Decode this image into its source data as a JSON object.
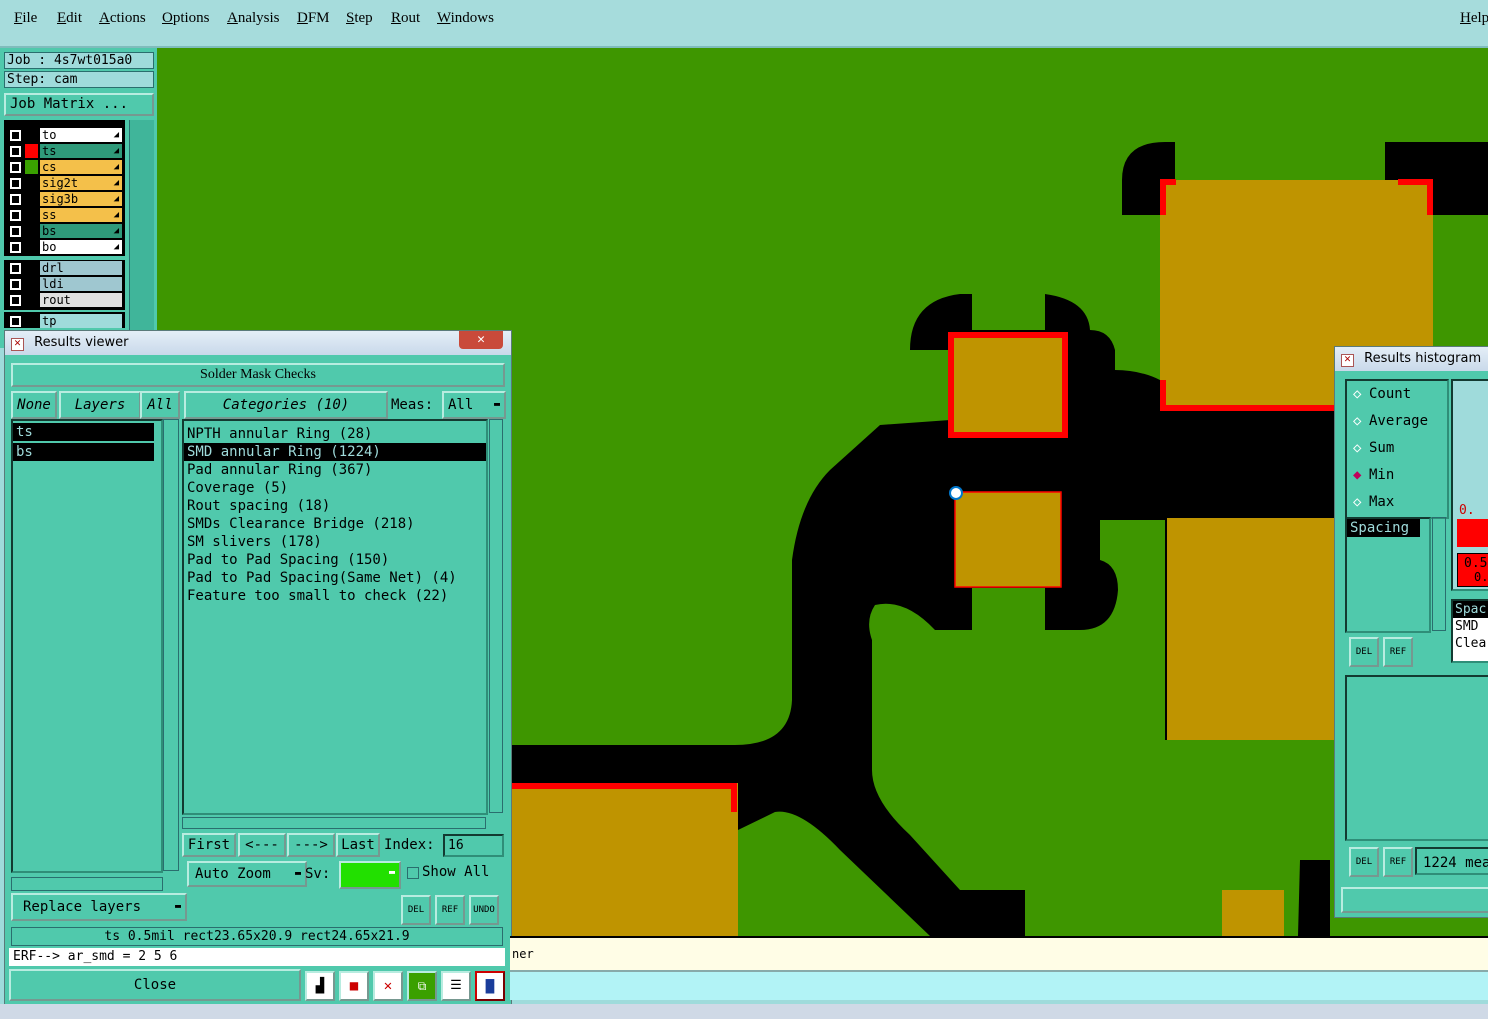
{
  "menubar": {
    "items": [
      "File",
      "Edit",
      "Actions",
      "Options",
      "Analysis",
      "DFM",
      "Step",
      "Rout",
      "Windows"
    ],
    "help": "Help"
  },
  "job": {
    "job_line": "Job : 4s7wt015a0",
    "step_line": "Step: cam",
    "matrix_button": "Job Matrix ..."
  },
  "layers": [
    {
      "name": "to",
      "color": "#ffffff",
      "swatch": "#000000"
    },
    {
      "name": "ts",
      "color": "#2f9a7a",
      "swatch": "#ff0000"
    },
    {
      "name": "cs",
      "color": "#f4c04a",
      "swatch": "#3aa000"
    },
    {
      "name": "sig2t",
      "color": "#f4c04a",
      "swatch": "#000000"
    },
    {
      "name": "sig3b",
      "color": "#f4c04a",
      "swatch": "#000000"
    },
    {
      "name": "ss",
      "color": "#f4c04a",
      "swatch": "#000000"
    },
    {
      "name": "bs",
      "color": "#2f9a7a",
      "swatch": "#000000"
    },
    {
      "name": "bo",
      "color": "#ffffff",
      "swatch": "#000000"
    }
  ],
  "layers2": [
    {
      "name": "drl",
      "color": "#9fc7d0"
    },
    {
      "name": "ldi",
      "color": "#9fc7d0"
    },
    {
      "name": "rout",
      "color": "#e0e0e0"
    },
    {
      "name": "tp",
      "color": "#9fdbdb"
    }
  ],
  "results_viewer": {
    "title": "Results viewer",
    "header": "Solder Mask Checks",
    "none_btn": "None",
    "layers_btn": "Layers",
    "all_btn": "All",
    "categories_btn": "Categories (10)",
    "meas_label": "Meas:",
    "meas_value": "All",
    "layer_list": [
      "ts",
      "bs"
    ],
    "categories": [
      "NPTH annular Ring (28)",
      "SMD annular Ring (1224)",
      "Pad annular Ring (367)",
      "Coverage (5)",
      "Rout spacing (18)",
      "SMDs Clearance Bridge (218)",
      "SM slivers (178)",
      "Pad to Pad Spacing (150)",
      "Pad to Pad Spacing(Same Net) (4)",
      "Feature too small to check (22)"
    ],
    "selected_category": 1,
    "nav": {
      "first": "First",
      "prev": "<---",
      "next": "--->",
      "last": "Last",
      "index_label": "Index:",
      "index_value": "16"
    },
    "auto_zoom": "Auto Zoom",
    "sv_label": "Sv:",
    "show_all": "Show All",
    "replace_layers": "Replace layers",
    "icons": {
      "del": "DEL",
      "ref": "REF",
      "undo": "UNDO"
    },
    "status": "ts 0.5mil   rect23.65x20.9   rect24.65x21.9",
    "erf": "ERF--> ar_smd = 2 5 6",
    "close": "Close"
  },
  "histogram": {
    "title": "Results histogram",
    "options": [
      "Count",
      "Average",
      "Sum",
      "Min",
      "Max"
    ],
    "selected_option": "Min",
    "list_item": "Spacing",
    "right_items": [
      "Spac",
      "SMD",
      "Clea"
    ],
    "value_labels": [
      "0.",
      "0.5",
      "0."
    ],
    "del": "DEL",
    "ref": "REF",
    "summary": "1224 mea"
  },
  "cmdline": {
    "text": "ner"
  },
  "colors": {
    "board_green": "#3e9600",
    "copper": "#bf9400",
    "mask_black": "#000000",
    "highlight_red": "#ff0000",
    "panel_teal": "#50c9ac"
  }
}
